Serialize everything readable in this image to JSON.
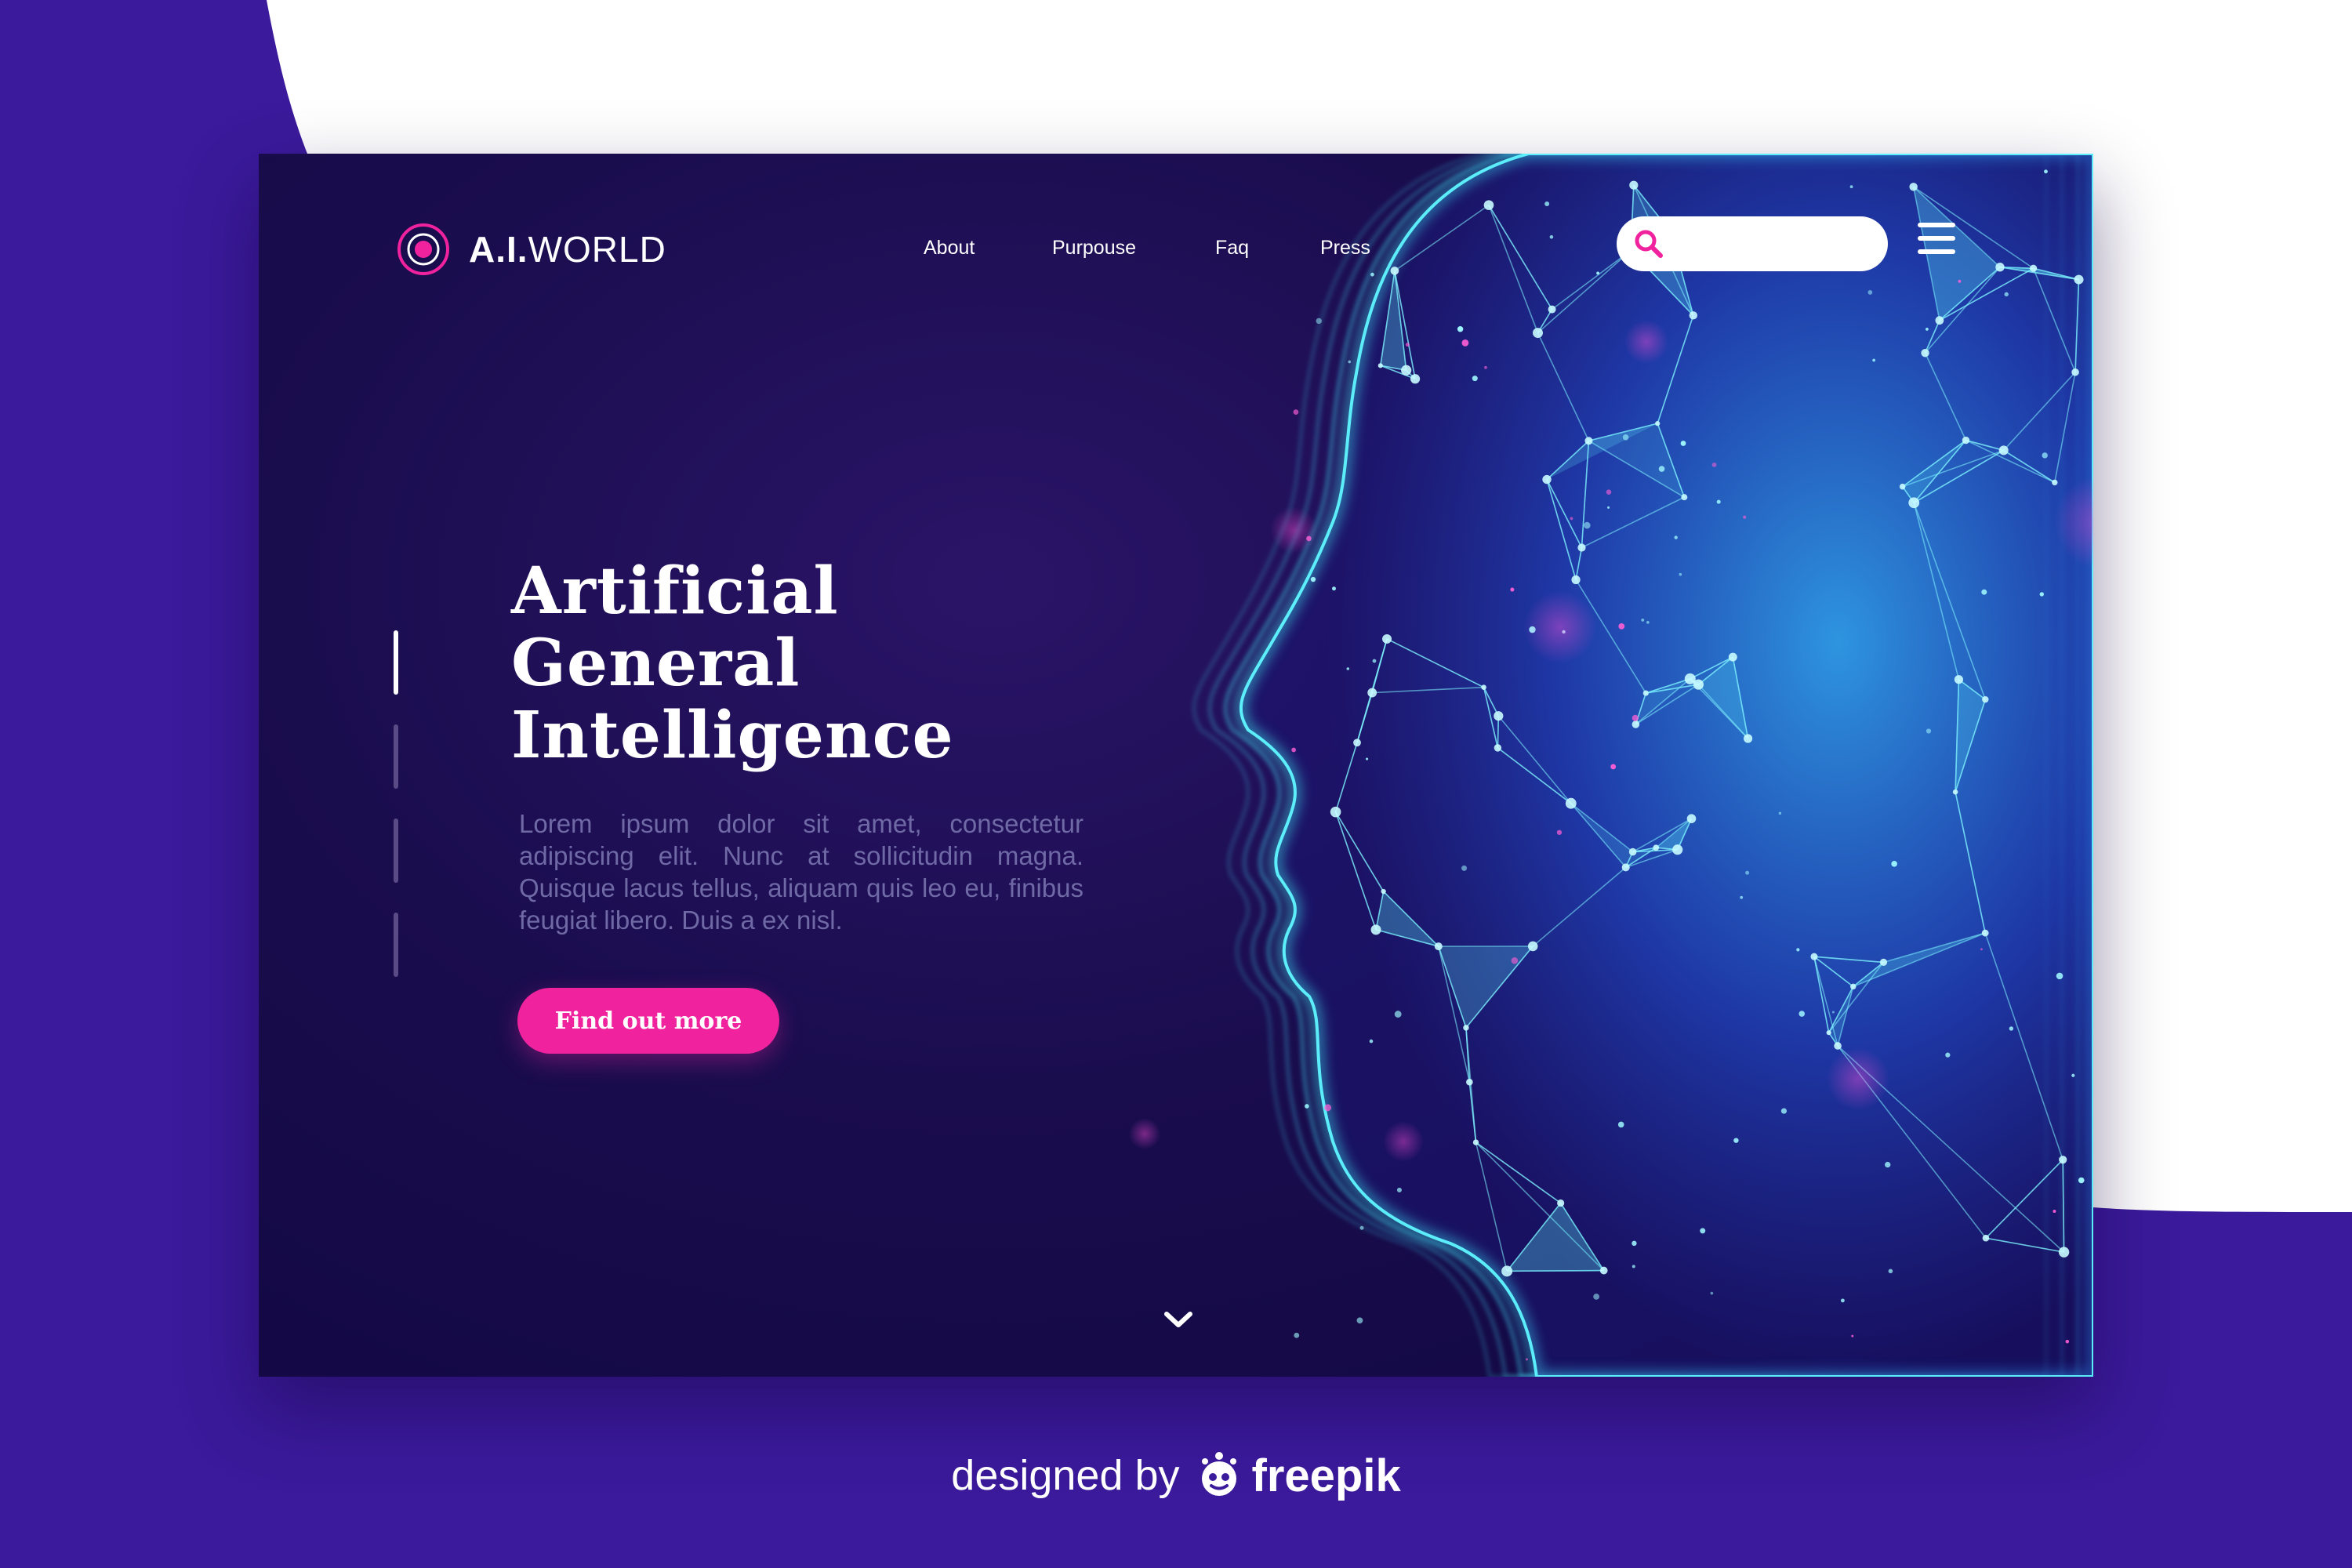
{
  "colors": {
    "page_background": "#3b1a9b",
    "card_background": "#1a0d4e",
    "accent_pink": "#f0229e",
    "face_cyan": "#34e0f0",
    "white": "#ffffff"
  },
  "header": {
    "logo_bold": "A.I.",
    "logo_light": "WORLD",
    "logo_icon": "target-ring-icon",
    "nav": [
      {
        "label": "About"
      },
      {
        "label": "Purpouse"
      },
      {
        "label": "Faq"
      },
      {
        "label": "Press"
      }
    ],
    "search": {
      "placeholder": "",
      "value": "",
      "icon": "search-icon"
    },
    "menu_icon": "hamburger-menu-icon"
  },
  "hero": {
    "title_lines": [
      "Artificial",
      "General",
      "Intelligence"
    ],
    "body": "Lorem ipsum dolor sit amet, consectetur adipiscing elit. Nunc at sollicitudin magna. Quisque lacus tellus, aliquam quis leo eu, finibus feugiat libero. Duis a ex nisl.",
    "cta_label": "Find out more",
    "slides": {
      "count": 4,
      "active": 1
    }
  },
  "scroll_icon": "chevron-down-icon",
  "credit": {
    "prefix": "designed by",
    "brand": "freepik",
    "brand_icon": "freepik-logo-icon"
  }
}
